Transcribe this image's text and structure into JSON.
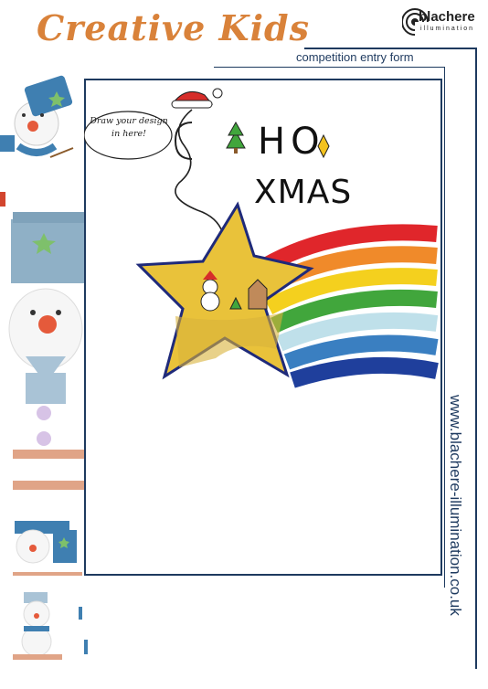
{
  "header": {
    "title": "Creative Kids",
    "subtitle": "competition entry form",
    "logo_name": "blachere",
    "logo_sub": "illumination"
  },
  "side": {
    "url": "www.blachere-illumination.co.uk"
  },
  "drawing": {
    "bubble": "Draw your design in here!",
    "ho": "HO",
    "xmas": "XMAS"
  },
  "colors": {
    "title": "#d9823a",
    "frame": "#1e3a5f",
    "rainbow": [
      "#e0262b",
      "#f08a2a",
      "#f4d01e",
      "#41a63c",
      "#bfe0ea",
      "#3a7fc1",
      "#1f3f9c"
    ],
    "star": "#e9c23a"
  },
  "icons": [
    "snowman-icon",
    "santa-hat-icon",
    "star-icon",
    "tree-icon",
    "house-icon",
    "blachere-logo-icon"
  ]
}
